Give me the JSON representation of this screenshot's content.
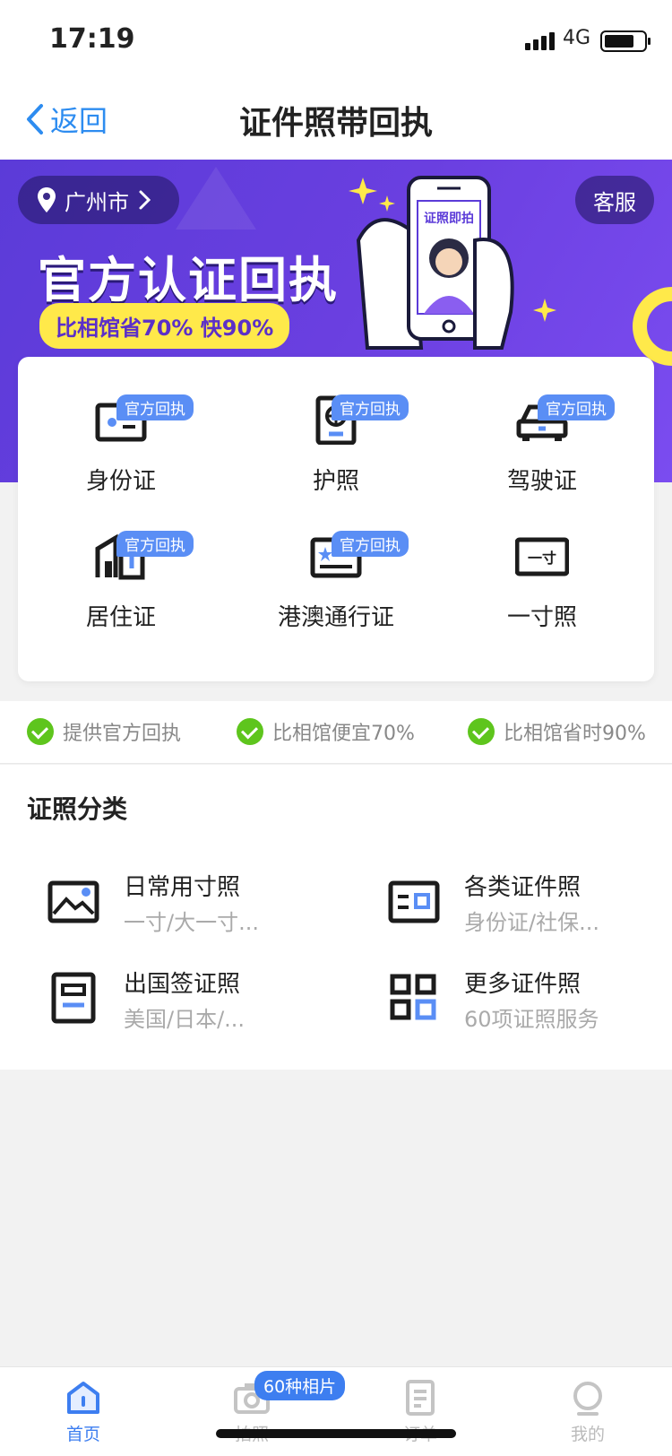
{
  "status": {
    "time": "17:19",
    "network": "4G"
  },
  "nav": {
    "back_label": "返回",
    "title": "证件照带回执"
  },
  "banner": {
    "city": "广州市",
    "service": "客服",
    "title": "官方认证回执",
    "subtitle": "比相馆省70% 快90%",
    "phone_caption": "证照即拍"
  },
  "doc_types": [
    {
      "label": "身份证",
      "badge": "官方回执",
      "icon": "id-card-icon"
    },
    {
      "label": "护照",
      "badge": "官方回执",
      "icon": "passport-icon"
    },
    {
      "label": "驾驶证",
      "badge": "官方回执",
      "icon": "car-icon"
    },
    {
      "label": "居住证",
      "badge": "官方回执",
      "icon": "residence-icon"
    },
    {
      "label": "港澳通行证",
      "badge": "官方回执",
      "icon": "travel-permit-icon"
    },
    {
      "label": "一寸照",
      "badge": "",
      "icon": "one-inch-photo-icon",
      "icon_text": "一寸"
    }
  ],
  "features": [
    "提供官方回执",
    "比相馆便宜70%",
    "比相馆省时90%"
  ],
  "categories": {
    "title": "证照分类",
    "items": [
      {
        "name": "日常用寸照",
        "desc": "一寸/大一寸...",
        "icon": "image-icon"
      },
      {
        "name": "各类证件照",
        "desc": "身份证/社保...",
        "icon": "card-icon"
      },
      {
        "name": "出国签证照",
        "desc": "美国/日本/...",
        "icon": "visa-icon"
      },
      {
        "name": "更多证件照",
        "desc": "60项证照服务",
        "icon": "grid-icon"
      }
    ]
  },
  "tabbar": {
    "badge": "60种相片",
    "items": [
      {
        "label": "首页",
        "icon": "home-icon",
        "active": true
      },
      {
        "label": "拍照",
        "icon": "camera-icon",
        "active": false
      },
      {
        "label": "订单",
        "icon": "order-icon",
        "active": false
      },
      {
        "label": "我的",
        "icon": "profile-icon",
        "active": false
      }
    ]
  },
  "colors": {
    "accent": "#3d7ef0",
    "banner": "#6a3fe0",
    "badge": "#5a8ef5",
    "check": "#5ec51d"
  }
}
